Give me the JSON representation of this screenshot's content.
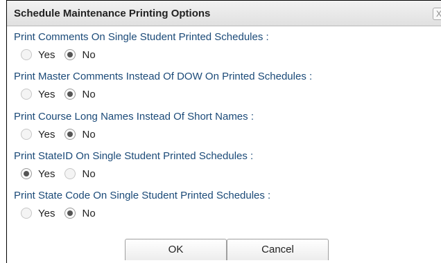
{
  "dialog": {
    "title": "Schedule Maintenance Printing Options",
    "close_label": "X"
  },
  "options": [
    {
      "label": "Print Comments On Single Student Printed Schedules :",
      "yes_label": "Yes",
      "no_label": "No",
      "selected": "No"
    },
    {
      "label": "Print Master Comments Instead Of DOW On Printed Schedules :",
      "yes_label": "Yes",
      "no_label": "No",
      "selected": "No"
    },
    {
      "label": "Print Course Long Names Instead Of Short Names :",
      "yes_label": "Yes",
      "no_label": "No",
      "selected": "No"
    },
    {
      "label": "Print StateID On Single Student Printed Schedules :",
      "yes_label": "Yes",
      "no_label": "No",
      "selected": "Yes"
    },
    {
      "label": "Print State Code On Single Student Printed Schedules :",
      "yes_label": "Yes",
      "no_label": "No",
      "selected": "No"
    }
  ],
  "buttons": {
    "ok_label": "OK",
    "cancel_label": "Cancel"
  }
}
